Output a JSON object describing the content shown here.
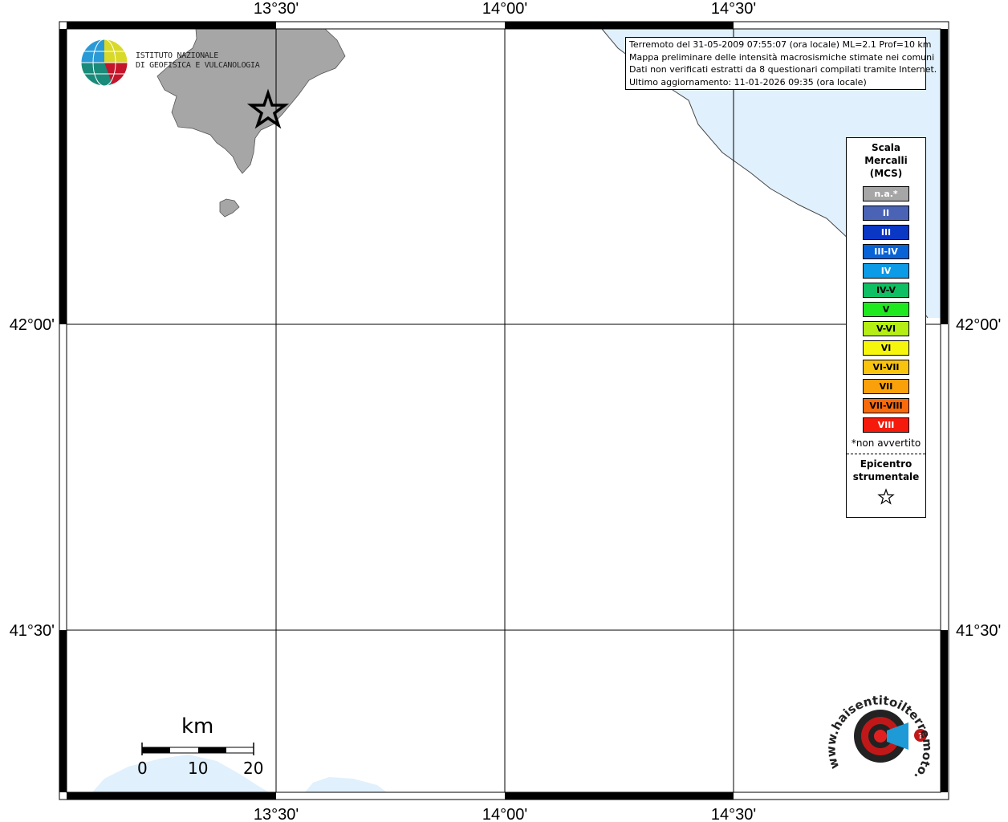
{
  "map": {
    "lon_labels": [
      "13°30'",
      "14°00'",
      "14°30'"
    ],
    "lat_labels": [
      "42°00'",
      "41°30'"
    ],
    "colors": {
      "land": "#a6a6a6",
      "sea": "#e0f0fc",
      "frame": "#000000",
      "grid": "#000000"
    },
    "epicenter_icon": "star-icon"
  },
  "info": {
    "line1": "Terremoto del 31-05-2009 07:55:07 (ora locale) ML=2.1 Prof=10 km",
    "line2": "Mappa preliminare delle intensità macrosismiche stimate nei comuni",
    "line3": "Dati non verificati estratti da 8 questionari compilati tramite Internet.",
    "line4": "Ultimo aggiornamento: 11-01-2026 09:35 (ora locale)"
  },
  "legend": {
    "title": "Scala Mercalli (MCS)",
    "items": [
      {
        "label": "n.a.*",
        "color": "#a6a6a6",
        "text_color": "#ffffff"
      },
      {
        "label": "II",
        "color": "#4a63b4",
        "text_color": "#ffffff"
      },
      {
        "label": "III",
        "color": "#0a37c4",
        "text_color": "#ffffff"
      },
      {
        "label": "III-IV",
        "color": "#0864d6",
        "text_color": "#ffffff"
      },
      {
        "label": "IV",
        "color": "#0c9be6",
        "text_color": "#ffffff"
      },
      {
        "label": "IV-V",
        "color": "#0fbf63",
        "text_color": "#000000"
      },
      {
        "label": "V",
        "color": "#1ee81e",
        "text_color": "#000000"
      },
      {
        "label": "V-VI",
        "color": "#b4ee14",
        "text_color": "#000000"
      },
      {
        "label": "VI",
        "color": "#f6f60d",
        "text_color": "#000000"
      },
      {
        "label": "VI-VII",
        "color": "#f8c40e",
        "text_color": "#000000"
      },
      {
        "label": "VII",
        "color": "#f9a00b",
        "text_color": "#000000"
      },
      {
        "label": "VII-VIII",
        "color": "#f96a0b",
        "text_color": "#000000"
      },
      {
        "label": "VIII",
        "color": "#f51a0b",
        "text_color": "#ffffff"
      }
    ],
    "note": "*non avvertito",
    "epicenter_label": "Epicentro strumentale"
  },
  "logo_ingv": {
    "line1": "ISTITUTO NAZIONALE",
    "line2": "DI GEOFISICA E VULCANOLOGIA"
  },
  "logo_hsit": {
    "text": "www.haisentitoilterremoto.it"
  },
  "scale": {
    "unit": "km",
    "labels": [
      "0",
      "10",
      "20"
    ]
  }
}
